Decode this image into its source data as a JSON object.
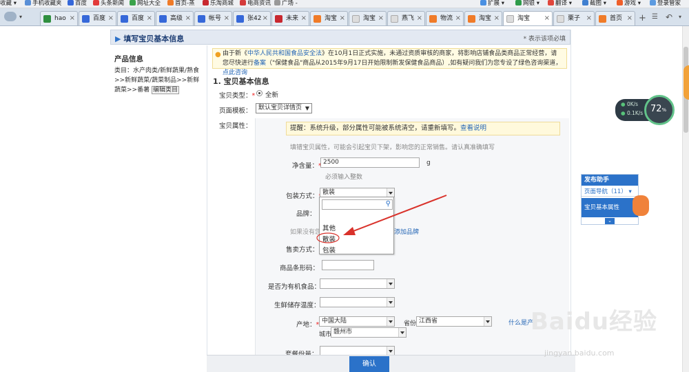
{
  "bookmarks": [
    "收藏",
    "手机收藏夹",
    "百度",
    "头条新闻",
    "网址大全",
    "首页-蒸",
    "乐淘商城",
    "电商资讯",
    "广场 -",
    "扩展",
    "网银",
    "翻译",
    "截图",
    "游戏",
    "登录管家"
  ],
  "tabs": [
    "hao",
    "百度",
    "百度",
    "高级",
    "帐号",
    "张42",
    "未来",
    "淘宝",
    "淘宝",
    "燕飞",
    "物流",
    "淘宝",
    "淘宝",
    "栗子",
    "首页"
  ],
  "header": {
    "title": "填写宝贝基本信息",
    "required_note": "* 表示该项必填"
  },
  "left": {
    "title": "产品信息",
    "category_text": "类目：水产肉类/新鲜蔬果/熟食>>新鲜蔬菜/蔬菜制品>>新鲜蔬菜>>番薯",
    "edit_link": "编辑类目"
  },
  "notice": {
    "part1": "由于新《",
    "law": "中华人民共和国食品安全法",
    "part2": "》在10月1日正式实施，未通过资质审核的商家，将影响店铺食品类商品正常经营，请您尽快进行",
    "link1": "备案",
    "part3": "（\"保健食品\"商品从2015年9月17日开始限制新发保健食品商品）,如有疑问我们为您专设了绿色咨询渠道，",
    "link2": "点此咨询"
  },
  "section": {
    "title": "1. 宝贝基本信息"
  },
  "form": {
    "type_label": "宝贝类型：",
    "type_value": "全新",
    "template_label": "页面模板：",
    "template_value": "默认宝贝详情页",
    "attr_label": "宝贝属性：",
    "tip_text": "提醒：系统升级，部分属性可能被系统清空，请重新填写。",
    "tip_link": "查看说明",
    "tip_sub": "填错宝贝属性，可能会引起宝贝下架，影响您的正常销售。请认真准确填写",
    "net_label": "净含量：",
    "net_value": "2500",
    "net_unit": "g",
    "net_hint": "必须输入整数",
    "pack_label": "包装方式：",
    "pack_value": "散装",
    "brand_label": "品牌：",
    "brand_hint": "如果没有您",
    "brand_link": "添加品牌",
    "sale_label": "售卖方式：",
    "barcode_label": "商品条形码：",
    "organic_label": "是否为有机食品：",
    "storage_label": "生鲜储存温度：",
    "origin_label": "产地：",
    "origin_value": "中国大陆",
    "province_label": "省份",
    "province_value": "江西省",
    "city_label": "城市",
    "city_value": "赣州市",
    "help_link": "什么是产",
    "package_label": "套餐份量："
  },
  "dropdown": {
    "options": [
      "其他",
      "散装",
      "包装"
    ]
  },
  "confirm_label": "确认",
  "helper": {
    "title": "发布助手",
    "nav": "页面导航（11）",
    "item": "宝贝基本属性"
  },
  "perf": {
    "up": "0K/s",
    "down": "0.1K/s",
    "pct": "72",
    "pct_unit": "%"
  },
  "watermark": {
    "brand": "Baidu经验",
    "url": "jingyan.baidu.com"
  },
  "colors": {
    "link": "#2365b5",
    "accent": "#2b72c9",
    "required": "#ee2222",
    "arrow": "#d9322b"
  }
}
